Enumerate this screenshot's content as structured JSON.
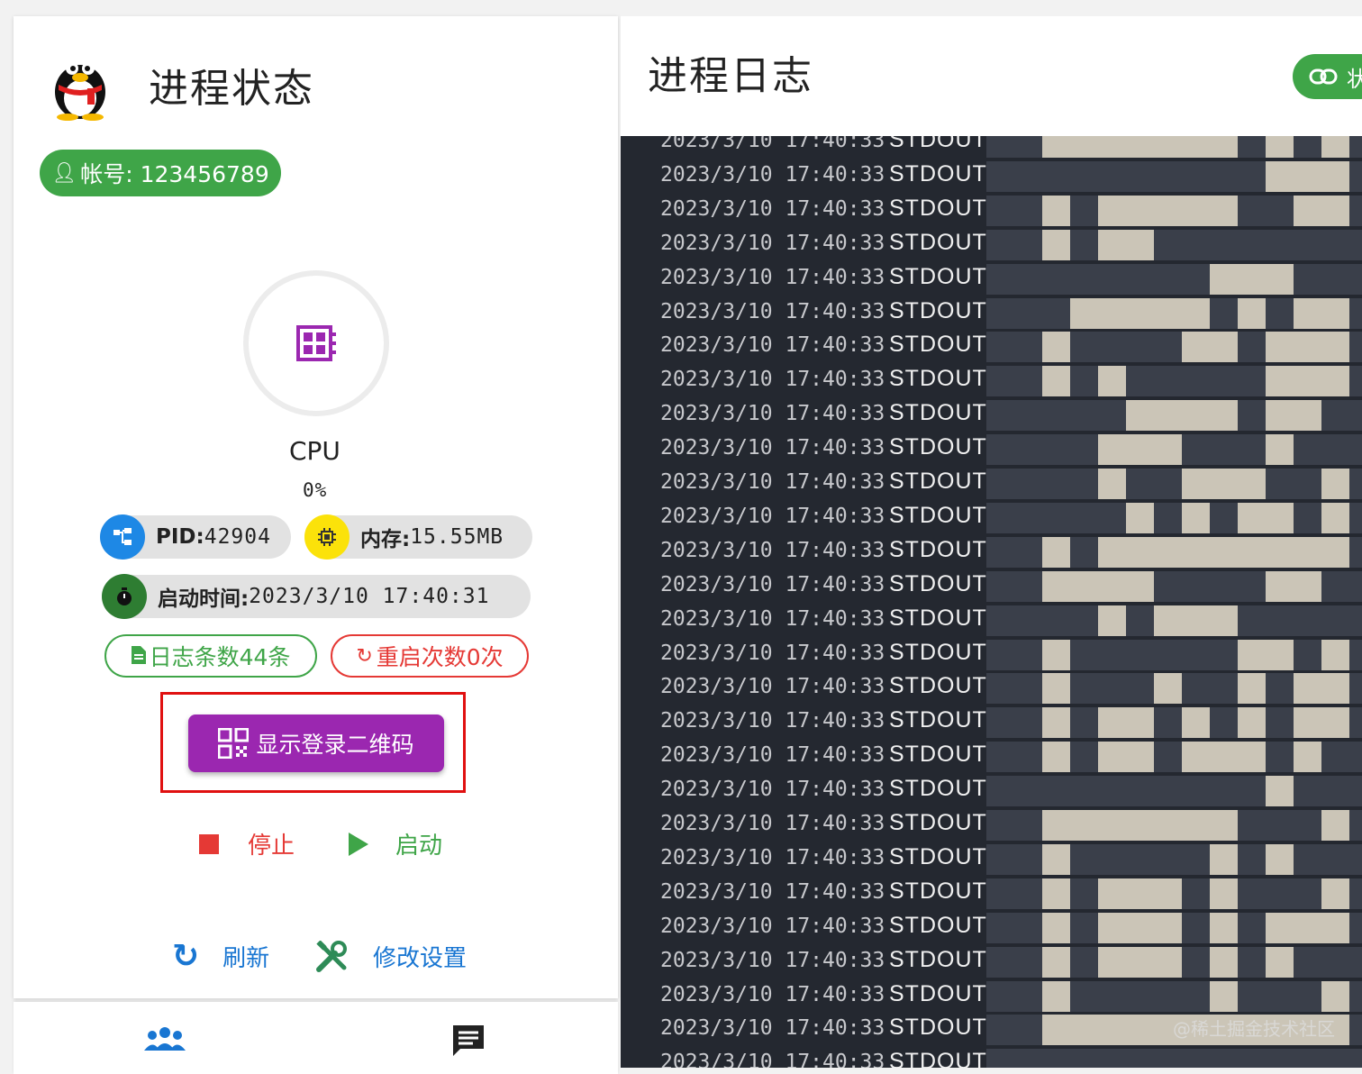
{
  "status_panel": {
    "title": "进程状态",
    "account": "帐号: 123456789",
    "cpu_label": "CPU",
    "cpu_value": "0%",
    "pid_label": "PID:",
    "pid_value": "42904",
    "memory_label": "内存:",
    "memory_value": "15.55MB",
    "start_time_label": "启动时间:",
    "start_time_value": "2023/3/10 17:40:31",
    "log_count": "日志条数44条",
    "restart_count": "重启次数0次",
    "qr_button": "显示登录二维码",
    "stop_label": "停止",
    "start_label": "启动",
    "refresh_label": "刷新",
    "settings_label": "修改设置"
  },
  "log_panel": {
    "title": "进程日志",
    "top_button_partial": "状",
    "watermark": "@稀土掘金技术社区",
    "rows": [
      {
        "time": "2023/3/10 17:40:33",
        "level": "STDOUT",
        "blocks": [
          [
            2,
            9
          ],
          [
            10,
            11
          ],
          [
            12,
            13
          ]
        ]
      },
      {
        "time": "2023/3/10 17:40:33",
        "level": "STDOUT",
        "blocks": [
          [
            10,
            13
          ]
        ]
      },
      {
        "time": "2023/3/10 17:40:33",
        "level": "STDOUT",
        "blocks": [
          [
            2,
            3
          ],
          [
            4,
            9
          ],
          [
            11,
            13
          ]
        ]
      },
      {
        "time": "2023/3/10 17:40:33",
        "level": "STDOUT",
        "blocks": [
          [
            2,
            3
          ],
          [
            4,
            6
          ]
        ]
      },
      {
        "time": "2023/3/10 17:40:33",
        "level": "STDOUT",
        "blocks": [
          [
            8,
            11
          ]
        ]
      },
      {
        "time": "2023/3/10 17:40:33",
        "level": "STDOUT",
        "blocks": [
          [
            3,
            8
          ],
          [
            9,
            10
          ],
          [
            11,
            13
          ]
        ]
      },
      {
        "time": "2023/3/10 17:40:33",
        "level": "STDOUT",
        "blocks": [
          [
            2,
            3
          ],
          [
            7,
            9
          ],
          [
            10,
            13
          ]
        ]
      },
      {
        "time": "2023/3/10 17:40:33",
        "level": "STDOUT",
        "blocks": [
          [
            2,
            3
          ],
          [
            4,
            5
          ],
          [
            10,
            13
          ]
        ]
      },
      {
        "time": "2023/3/10 17:40:33",
        "level": "STDOUT",
        "blocks": [
          [
            5,
            9
          ],
          [
            10,
            12
          ]
        ]
      },
      {
        "time": "2023/3/10 17:40:33",
        "level": "STDOUT",
        "blocks": [
          [
            4,
            7
          ],
          [
            10,
            11
          ]
        ]
      },
      {
        "time": "2023/3/10 17:40:33",
        "level": "STDOUT",
        "blocks": [
          [
            4,
            5
          ],
          [
            7,
            10
          ],
          [
            12,
            13
          ]
        ]
      },
      {
        "time": "2023/3/10 17:40:33",
        "level": "STDOUT",
        "blocks": [
          [
            5,
            6
          ],
          [
            7,
            8
          ],
          [
            9,
            11
          ],
          [
            12,
            13
          ]
        ]
      },
      {
        "time": "2023/3/10 17:40:33",
        "level": "STDOUT",
        "blocks": [
          [
            2,
            3
          ],
          [
            4,
            13
          ]
        ]
      },
      {
        "time": "2023/3/10 17:40:33",
        "level": "STDOUT",
        "blocks": [
          [
            2,
            6
          ],
          [
            10,
            12
          ]
        ]
      },
      {
        "time": "2023/3/10 17:40:33",
        "level": "STDOUT",
        "blocks": [
          [
            4,
            5
          ],
          [
            6,
            9
          ]
        ]
      },
      {
        "time": "2023/3/10 17:40:33",
        "level": "STDOUT",
        "blocks": [
          [
            2,
            3
          ],
          [
            9,
            11
          ],
          [
            12,
            13
          ]
        ]
      },
      {
        "time": "2023/3/10 17:40:33",
        "level": "STDOUT",
        "blocks": [
          [
            2,
            3
          ],
          [
            6,
            7
          ],
          [
            9,
            10
          ],
          [
            11,
            13
          ]
        ]
      },
      {
        "time": "2023/3/10 17:40:33",
        "level": "STDOUT",
        "blocks": [
          [
            2,
            3
          ],
          [
            4,
            6
          ],
          [
            7,
            8
          ],
          [
            9,
            10
          ],
          [
            11,
            13
          ]
        ]
      },
      {
        "time": "2023/3/10 17:40:33",
        "level": "STDOUT",
        "blocks": [
          [
            2,
            3
          ],
          [
            4,
            6
          ],
          [
            7,
            10
          ],
          [
            11,
            12
          ]
        ]
      },
      {
        "time": "2023/3/10 17:40:33",
        "level": "STDOUT",
        "blocks": [
          [
            10,
            11
          ]
        ]
      },
      {
        "time": "2023/3/10 17:40:33",
        "level": "STDOUT",
        "blocks": [
          [
            2,
            9
          ],
          [
            12,
            13
          ]
        ]
      },
      {
        "time": "2023/3/10 17:40:33",
        "level": "STDOUT",
        "blocks": [
          [
            2,
            3
          ],
          [
            8,
            9
          ],
          [
            10,
            11
          ]
        ]
      },
      {
        "time": "2023/3/10 17:40:33",
        "level": "STDOUT",
        "blocks": [
          [
            2,
            3
          ],
          [
            4,
            7
          ],
          [
            8,
            9
          ],
          [
            12,
            13
          ]
        ]
      },
      {
        "time": "2023/3/10 17:40:33",
        "level": "STDOUT",
        "blocks": [
          [
            2,
            3
          ],
          [
            4,
            7
          ],
          [
            8,
            9
          ],
          [
            10,
            13
          ]
        ]
      },
      {
        "time": "2023/3/10 17:40:33",
        "level": "STDOUT",
        "blocks": [
          [
            2,
            3
          ],
          [
            4,
            7
          ],
          [
            8,
            9
          ],
          [
            10,
            11
          ]
        ]
      },
      {
        "time": "2023/3/10 17:40:33",
        "level": "STDOUT",
        "blocks": [
          [
            2,
            3
          ],
          [
            8,
            9
          ],
          [
            12,
            13
          ]
        ]
      },
      {
        "time": "2023/3/10 17:40:33",
        "level": "STDOUT",
        "blocks": [
          [
            2,
            13
          ]
        ]
      },
      {
        "time": "2023/3/10 17:40:33",
        "level": "STDOUT",
        "blocks": []
      }
    ]
  },
  "colors": {
    "green": "#3fa548",
    "purple": "#9b27b0",
    "red": "#e53935",
    "blue": "#1976d2"
  }
}
